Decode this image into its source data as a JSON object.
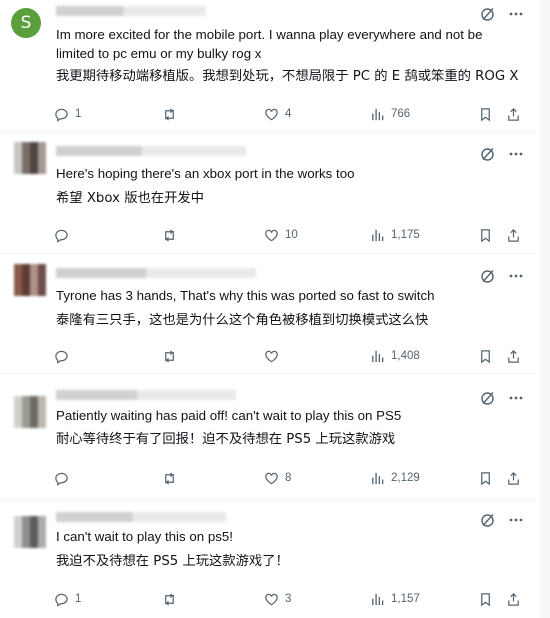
{
  "replies": [
    {
      "avatar_letter": "S",
      "text": "Im more excited for the mobile port. I wanna play everywhere and not be limited to pc emu or my bulky rog x",
      "translation": "我更期待移动端移植版。我想到处玩，不想局限于 PC 的 E 鸹或笨重的 ROG X",
      "replies": "1",
      "reposts": "",
      "likes": "4",
      "views": "766"
    },
    {
      "text": "Here's hoping there's an xbox port in the works too",
      "translation": "希望 Xbox 版也在开发中",
      "replies": "",
      "reposts": "",
      "likes": "10",
      "views": "1,175"
    },
    {
      "text": "Tyrone has 3 hands, That's why this was ported so fast to switch",
      "translation": "泰隆有三只手，这也是为什么这个角色被移植到切换模式这么快",
      "replies": "",
      "reposts": "",
      "likes": "",
      "views": "1,408"
    },
    {
      "text": "Patiently waiting has paid off! can't wait to play this on PS5",
      "translation": "耐心等待终于有了回报！迫不及待想在 PS5 上玩这款游戏",
      "replies": "",
      "reposts": "",
      "likes": "8",
      "views": "2,129"
    },
    {
      "text": "I can't wait to play this on ps5!",
      "translation": "我迫不及待想在 PS5 上玩这款游戏了！",
      "replies": "1",
      "reposts": "",
      "likes": "3",
      "views": "1,157"
    }
  ],
  "colors": {
    "text": "#0f1419",
    "muted": "#536471",
    "avatar_green": "#5b9f3d",
    "divider": "#eff3f4"
  }
}
